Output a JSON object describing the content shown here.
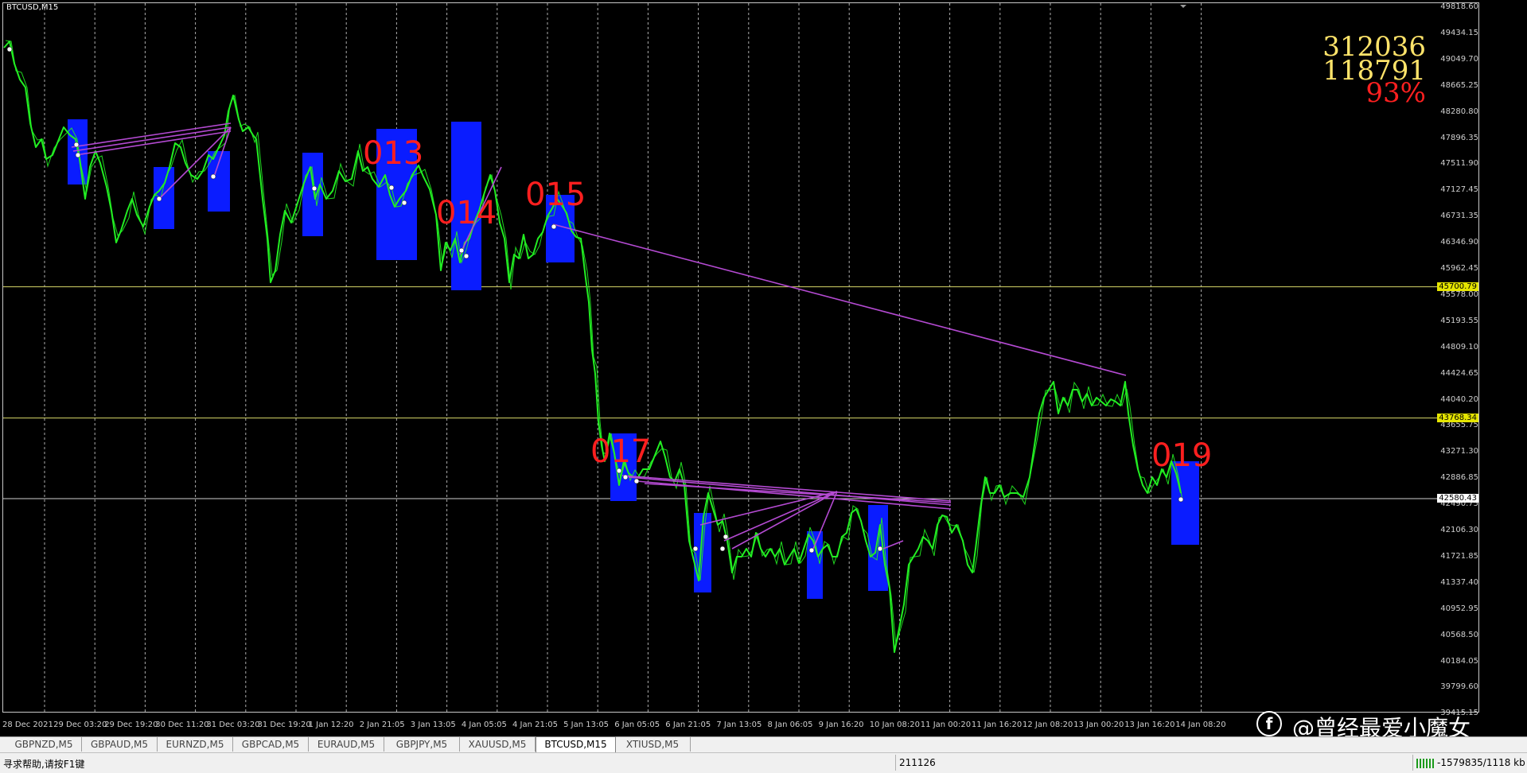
{
  "chart": {
    "title": "BTCUSD,M15",
    "price_ticks": [
      "49818.60",
      "49434.15",
      "49049.70",
      "48665.25",
      "48280.80",
      "47896.35",
      "47511.90",
      "47127.45",
      "46731.35",
      "46346.90",
      "45962.45",
      "45578.00",
      "45193.55",
      "44809.10",
      "44424.65",
      "44040.20",
      "43655.75",
      "43271.30",
      "42886.85",
      "42490.75",
      "42106.30",
      "41721.85",
      "41337.40",
      "40952.95",
      "40568.50",
      "40184.05",
      "39799.60",
      "39415.15"
    ],
    "price_tags": [
      {
        "label": "45700.79",
        "price": 45700.79,
        "bg": "#e5e500",
        "fg": "#000000"
      },
      {
        "label": "43768.34",
        "price": 43768.34,
        "bg": "#e5e500",
        "fg": "#000000"
      },
      {
        "label": "42580.43",
        "price": 42580.43,
        "bg": "#ffffff",
        "fg": "#000000"
      }
    ],
    "time_labels": [
      "28 Dec 2021",
      "29 Dec 03:20",
      "29 Dec 19:20",
      "30 Dec 11:20",
      "31 Dec 03:20",
      "31 Dec 19:20",
      "1 Jan 12:20",
      "2 Jan 21:05",
      "3 Jan 13:05",
      "4 Jan 05:05",
      "4 Jan 21:05",
      "5 Jan 13:05",
      "6 Jan 05:05",
      "6 Jan 21:05",
      "7 Jan 13:05",
      "8 Jan 06:05",
      "9 Jan 16:20",
      "10 Jan 08:20",
      "11 Jan 00:20",
      "11 Jan 16:20",
      "12 Jan 08:20",
      "13 Jan 00:20",
      "13 Jan 16:20",
      "14 Jan 08:20"
    ],
    "stats": [
      {
        "value": "312036",
        "color": "#ffe46a"
      },
      {
        "value": "118791",
        "color": "#ffe46a"
      },
      {
        "value": "93%",
        "color": "#ff2020"
      }
    ],
    "signal_labels": [
      "013",
      "014",
      "015",
      "017",
      "019"
    ],
    "colors": {
      "price_line": "#22ee22",
      "grid": "#d8d8d8",
      "box": "#0a1cff",
      "trend": "#b44ad2",
      "signal": "#ff1f1f"
    }
  },
  "tabs": [
    "GBPNZD,M5",
    "GBPAUD,M5",
    "EURNZD,M5",
    "GBPCAD,M5",
    "EURAUD,M5",
    "GBPJPY,M5",
    "XAUUSD,M5",
    "BTCUSD,M15",
    "XTIUSD,M5"
  ],
  "active_tab": "BTCUSD,M15",
  "status": {
    "help": "寻求帮助,请按F1键",
    "value": "211126",
    "traffic": "-1579835/1118 kb"
  },
  "watermark": {
    "text": "@曾经最爱小魔女"
  }
}
